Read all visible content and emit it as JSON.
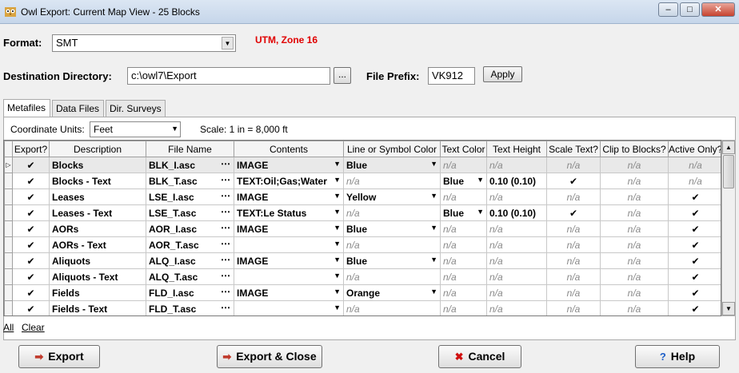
{
  "window": {
    "title": "Owl Export: Current Map View - 25 Blocks",
    "min": "–",
    "max": "□",
    "close": "✕"
  },
  "format": {
    "label": "Format:",
    "value": "SMT",
    "projection": "UTM, Zone 16"
  },
  "destination": {
    "label": "Destination Directory:",
    "value": "c:\\owl7\\Export",
    "browse": "...",
    "prefix_label": "File Prefix:",
    "prefix_value": "VK912",
    "apply": "Apply"
  },
  "tabs": [
    "Metafiles",
    "Data Files",
    "Dir. Surveys"
  ],
  "coord": {
    "label": "Coordinate Units:",
    "value": "Feet",
    "scale": "Scale: 1 in = 8,000 ft"
  },
  "columns": [
    "Export?",
    "Description",
    "File Name",
    "Contents",
    "Line or Symbol Color",
    "Text Color",
    "Text Height",
    "Scale Text?",
    "Clip to Blocks?",
    "Active Only?"
  ],
  "rows": [
    {
      "export": "✔",
      "desc": "Blocks",
      "file": "BLK_I.asc",
      "contents": "IMAGE",
      "color": "Blue",
      "textcolor": "n/a",
      "height": "n/a",
      "scale": "n/a",
      "clip": "n/a",
      "active": "n/a"
    },
    {
      "export": "✔",
      "desc": "Blocks - Text",
      "file": "BLK_T.asc",
      "contents": "TEXT:Oil;Gas;Water",
      "color": "n/a",
      "textcolor": "Blue",
      "height": "0.10  (0.10)",
      "scale": "✔",
      "clip": "n/a",
      "active": "n/a"
    },
    {
      "export": "✔",
      "desc": "Leases",
      "file": "LSE_I.asc",
      "contents": "IMAGE",
      "color": "Yellow",
      "textcolor": "n/a",
      "height": "n/a",
      "scale": "n/a",
      "clip": "n/a",
      "active": "✔"
    },
    {
      "export": "✔",
      "desc": "Leases - Text",
      "file": "LSE_T.asc",
      "contents": "TEXT:Le Status",
      "color": "n/a",
      "textcolor": "Blue",
      "height": "0.10  (0.10)",
      "scale": "✔",
      "clip": "n/a",
      "active": "✔"
    },
    {
      "export": "✔",
      "desc": "AORs",
      "file": "AOR_I.asc",
      "contents": "IMAGE",
      "color": "Blue",
      "textcolor": "n/a",
      "height": "n/a",
      "scale": "n/a",
      "clip": "n/a",
      "active": "✔"
    },
    {
      "export": "✔",
      "desc": "AORs - Text",
      "file": "AOR_T.asc",
      "contents": "",
      "color": "n/a",
      "textcolor": "n/a",
      "height": "n/a",
      "scale": "n/a",
      "clip": "n/a",
      "active": "✔"
    },
    {
      "export": "✔",
      "desc": "Aliquots",
      "file": "ALQ_I.asc",
      "contents": "IMAGE",
      "color": "Blue",
      "textcolor": "n/a",
      "height": "n/a",
      "scale": "n/a",
      "clip": "n/a",
      "active": "✔"
    },
    {
      "export": "✔",
      "desc": "Aliquots - Text",
      "file": "ALQ_T.asc",
      "contents": "",
      "color": "n/a",
      "textcolor": "n/a",
      "height": "n/a",
      "scale": "n/a",
      "clip": "n/a",
      "active": "✔"
    },
    {
      "export": "✔",
      "desc": "Fields",
      "file": "FLD_I.asc",
      "contents": "IMAGE",
      "color": "Orange",
      "textcolor": "n/a",
      "height": "n/a",
      "scale": "n/a",
      "clip": "n/a",
      "active": "✔"
    },
    {
      "export": "✔",
      "desc": "Fields - Text",
      "file": "FLD_T.asc",
      "contents": "",
      "color": "n/a",
      "textcolor": "n/a",
      "height": "n/a",
      "scale": "n/a",
      "clip": "n/a",
      "active": "✔"
    }
  ],
  "links": {
    "all": "All",
    "clear": "Clear"
  },
  "buttons": {
    "export": "Export",
    "export_close": "Export & Close",
    "cancel": "Cancel",
    "help": "Help"
  }
}
